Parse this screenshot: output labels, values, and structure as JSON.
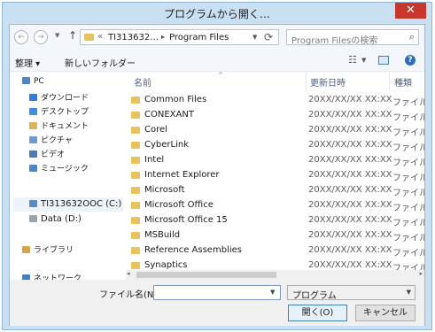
{
  "window": {
    "title": "プログラムから開く…",
    "close_glyph": "✕"
  },
  "nav": {
    "back_icon": "back-arrow-icon",
    "forward_icon": "forward-arrow-icon",
    "address": {
      "segments": [
        "TI313632…",
        "Program Files"
      ]
    },
    "search_placeholder": "Program Filesの検索"
  },
  "toolbar": {
    "organize_label": "整理 ▾",
    "new_folder_label": "新しいフォルダー"
  },
  "sidebar": {
    "items": [
      {
        "label": "PC",
        "icon": "computer-icon",
        "color": "#4f86c6"
      },
      {
        "label": "ダウンロード",
        "icon": "download-folder-icon",
        "color": "#2f7fd6"
      },
      {
        "label": "デスクトップ",
        "icon": "desktop-folder-icon",
        "color": "#3b8ee0"
      },
      {
        "label": "ドキュメント",
        "icon": "documents-folder-icon",
        "color": "#d9b35a"
      },
      {
        "label": "ピクチャ",
        "icon": "pictures-folder-icon",
        "color": "#6a9ad1"
      },
      {
        "label": "ビデオ",
        "icon": "videos-folder-icon",
        "color": "#4c7bb5"
      },
      {
        "label": "ミュージック",
        "icon": "music-folder-icon",
        "color": "#4a86c8"
      },
      {
        "label": "TI313632OOC (C:)",
        "icon": "system-drive-icon",
        "color": "#5b89c2"
      },
      {
        "label": "Data (D:)",
        "icon": "drive-icon",
        "color": "#9aa4ae"
      },
      {
        "label": "ライブラリ",
        "icon": "libraries-icon",
        "color": "#d9a441"
      },
      {
        "label": "ネットワーク",
        "icon": "network-icon",
        "color": "#3f7fc8"
      }
    ]
  },
  "columns": {
    "name": "名前",
    "date": "更新日時",
    "type": "種類"
  },
  "files": [
    {
      "name": "Common Files",
      "date": "20XX/XX/XX XX:XX",
      "type": "ファイル"
    },
    {
      "name": "CONEXANT",
      "date": "20XX/XX/XX XX:XX",
      "type": "ファイル"
    },
    {
      "name": "Corel",
      "date": "20XX/XX/XX XX:XX",
      "type": "ファイル"
    },
    {
      "name": "CyberLink",
      "date": "20XX/XX/XX XX:XX",
      "type": "ファイル"
    },
    {
      "name": "Intel",
      "date": "20XX/XX/XX XX:XX",
      "type": "ファイル"
    },
    {
      "name": "Internet Explorer",
      "date": "20XX/XX/XX XX:XX",
      "type": "ファイル"
    },
    {
      "name": "Microsoft",
      "date": "20XX/XX/XX XX:XX",
      "type": "ファイル"
    },
    {
      "name": "Microsoft Office",
      "date": "20XX/XX/XX XX:XX",
      "type": "ファイル"
    },
    {
      "name": "Microsoft Office 15",
      "date": "20XX/XX/XX XX:XX",
      "type": "ファイル"
    },
    {
      "name": "MSBuild",
      "date": "20XX/XX/XX XX:XX",
      "type": "ファイル"
    },
    {
      "name": "Reference Assemblies",
      "date": "20XX/XX/XX XX:XX",
      "type": "ファイル"
    },
    {
      "name": "Synaptics",
      "date": "20XX/XX/XX XX:XX",
      "type": "ファイル"
    }
  ],
  "bottom": {
    "filename_label": "ファイル名(N):",
    "filename_value": "",
    "filetype_value": "プログラム",
    "open_label": "開く(O)",
    "cancel_label": "キャンセル"
  },
  "colors": {
    "title_bg": "#c9dff2",
    "close_bg": "#c7372b",
    "folder": "#e9c25d",
    "selected_bg": "#eef3f9"
  }
}
